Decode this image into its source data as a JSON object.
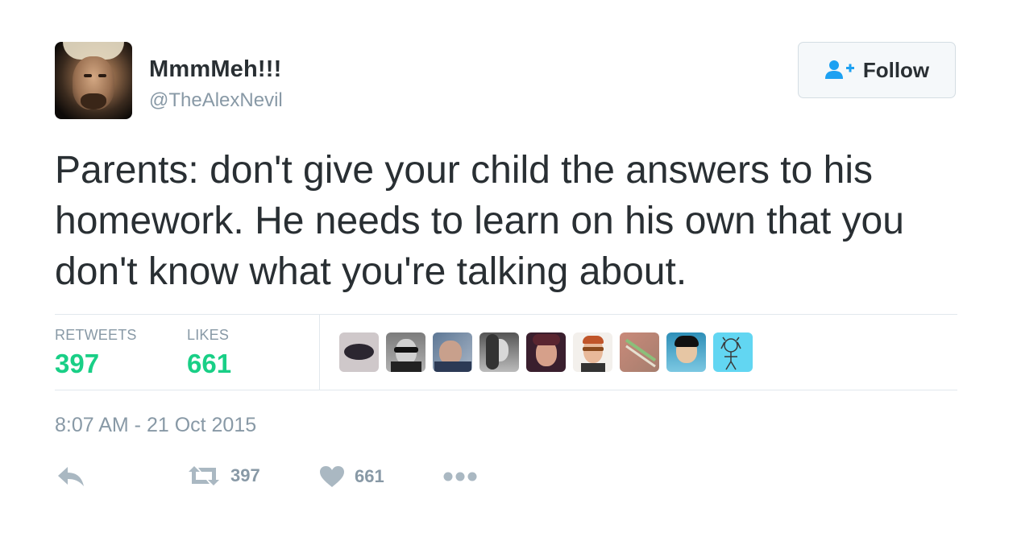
{
  "author": {
    "name": "MmmMeh!!!",
    "handle": "@TheAlexNevil"
  },
  "follow_button": {
    "label": "Follow",
    "icon": "person-add-icon",
    "accent": "#1da1f2"
  },
  "tweet": {
    "text": "Parents: don't give your child the answers to his homework. He needs to learn on his own that you don't know what you're talking about.",
    "timestamp": "8:07 AM - 21 Oct 2015"
  },
  "stats": {
    "retweets_label": "RETWEETS",
    "retweets_count": "397",
    "likes_label": "LIKES",
    "likes_count": "661",
    "count_color": "#19cf86"
  },
  "liker_avatars": [
    {
      "bg": "#c9c2c4"
    },
    {
      "bg": "#9a9a9a"
    },
    {
      "bg": "#7a8fa8"
    },
    {
      "bg": "#8a8a8a"
    },
    {
      "bg": "#3a1f2e"
    },
    {
      "bg": "#f3f0ec"
    },
    {
      "bg": "#b88a7a"
    },
    {
      "bg": "#5aa6c9"
    },
    {
      "bg": "#62d6f2"
    }
  ],
  "actions": {
    "reply_icon": "reply-icon",
    "retweet_icon": "retweet-icon",
    "retweet_count": "397",
    "like_icon": "heart-icon",
    "like_count": "661",
    "more_icon": "more-icon"
  }
}
